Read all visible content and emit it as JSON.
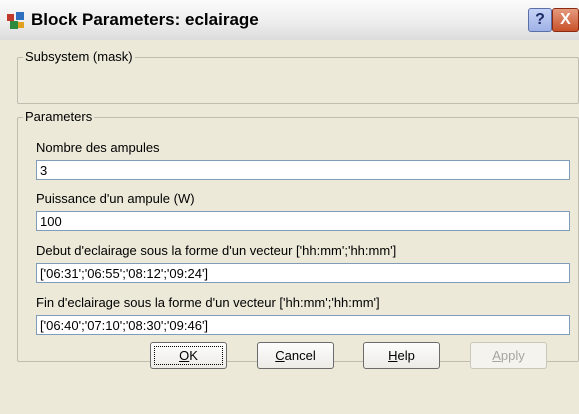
{
  "window": {
    "title": "Block Parameters: eclairage",
    "help_glyph": "?",
    "close_glyph": "X"
  },
  "subsystem": {
    "legend": "Subsystem (mask)"
  },
  "parameters": {
    "legend": "Parameters",
    "fields": [
      {
        "label": "Nombre des ampules",
        "value": "3"
      },
      {
        "label": "Puissance d'un ampule (W)",
        "value": "100"
      },
      {
        "label": "Debut d'eclairage sous la forme d'un vecteur ['hh:mm';'hh:mm']",
        "value": "['06:31';'06:55';'08:12';'09:24']"
      },
      {
        "label": "Fin d'eclairage sous la forme d'un vecteur ['hh:mm';'hh:mm']",
        "value": "['06:40';'07:10';'08:30';'09:46']"
      }
    ]
  },
  "buttons": {
    "ok": {
      "mnemonic": "O",
      "rest": "K"
    },
    "cancel": {
      "mnemonic": "C",
      "rest": "ancel"
    },
    "help": {
      "mnemonic": "H",
      "rest": "elp"
    },
    "apply": {
      "mnemonic": "A",
      "rest": "pply"
    }
  },
  "colors": {
    "dialog_bg": "#ece9d8",
    "input_border": "#7f9db9",
    "disabled_text": "#a7a6a0"
  }
}
